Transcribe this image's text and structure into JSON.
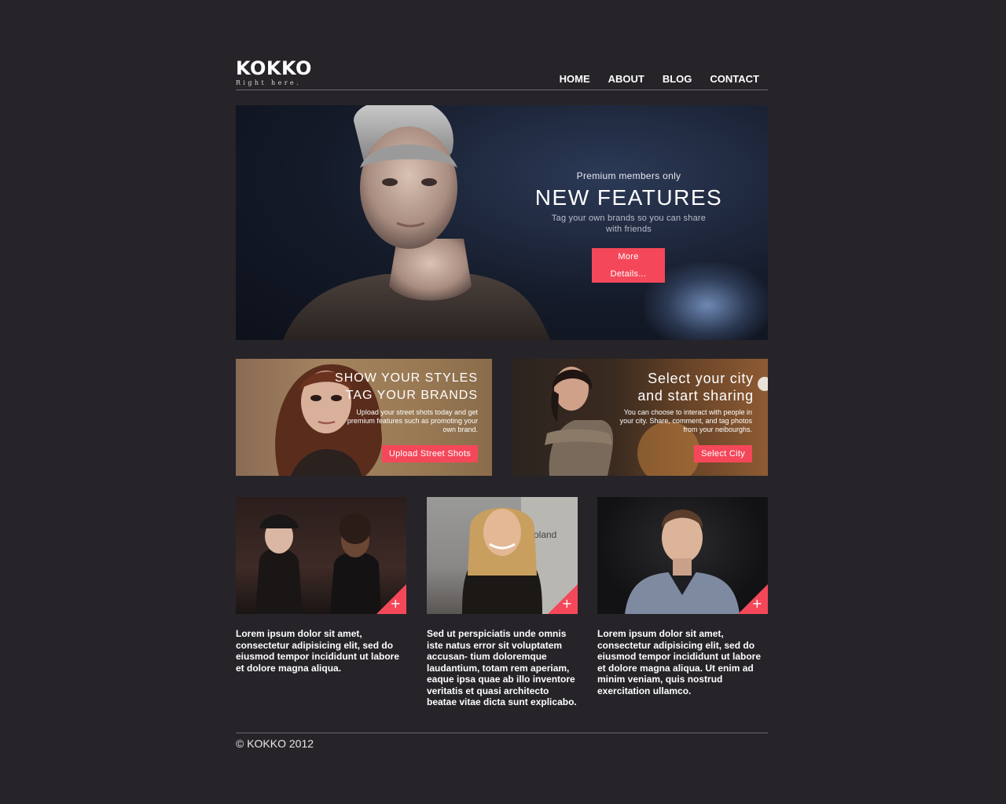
{
  "brand": {
    "name": "KOKKO",
    "tagline": "Right here."
  },
  "nav": {
    "items": [
      "HOME",
      "ABOUT",
      "BLOG",
      "CONTACT"
    ]
  },
  "hero": {
    "kicker": "Premium members only",
    "title": "NEW FEATURES",
    "subtitle": "Tag your own brands so you can share with friends",
    "button": "More Details..."
  },
  "promos": [
    {
      "title_line1": "SHOW YOUR STYLES",
      "title_line2": "TAG YOUR BRANDS",
      "description": "Upload your street shots today and get premium features such as promoting your own brand.",
      "button": "Upload Street Shots"
    },
    {
      "title_line1": "Select your city",
      "title_line2": "and start sharing",
      "description": "You can choose to interact with people in your city. Share, comment, and tag photos from your neibourghs.",
      "button": "Select City"
    }
  ],
  "thumbnails": [
    {
      "caption": "Lorem ipsum dolor sit amet, consectetur adipisicing elit, sed do eiusmod tempor incididunt ut labore et dolore magna aliqua."
    },
    {
      "caption": "Sed ut perspiciatis unde omnis iste natus error sit voluptatem accusan- tium doloremque laudantium, totam rem aperiam, eaque ipsa quae ab illo inventore veritatis et quasi architecto beatae vitae dicta sunt explicabo.",
      "sign_text": "roland"
    },
    {
      "caption": "Lorem ipsum dolor sit amet, consectetur adipisicing elit, sed do eiusmod tempor incididunt ut labore et dolore magna aliqua. Ut enim ad minim veniam, quis nostrud exercitation ullamco."
    }
  ],
  "icons": {
    "corner": "plus-icon"
  },
  "colors": {
    "background": "#262428",
    "accent": "#f4485a",
    "text": "#ffffff"
  },
  "footer": {
    "copyright": "© KOKKO 2012"
  }
}
